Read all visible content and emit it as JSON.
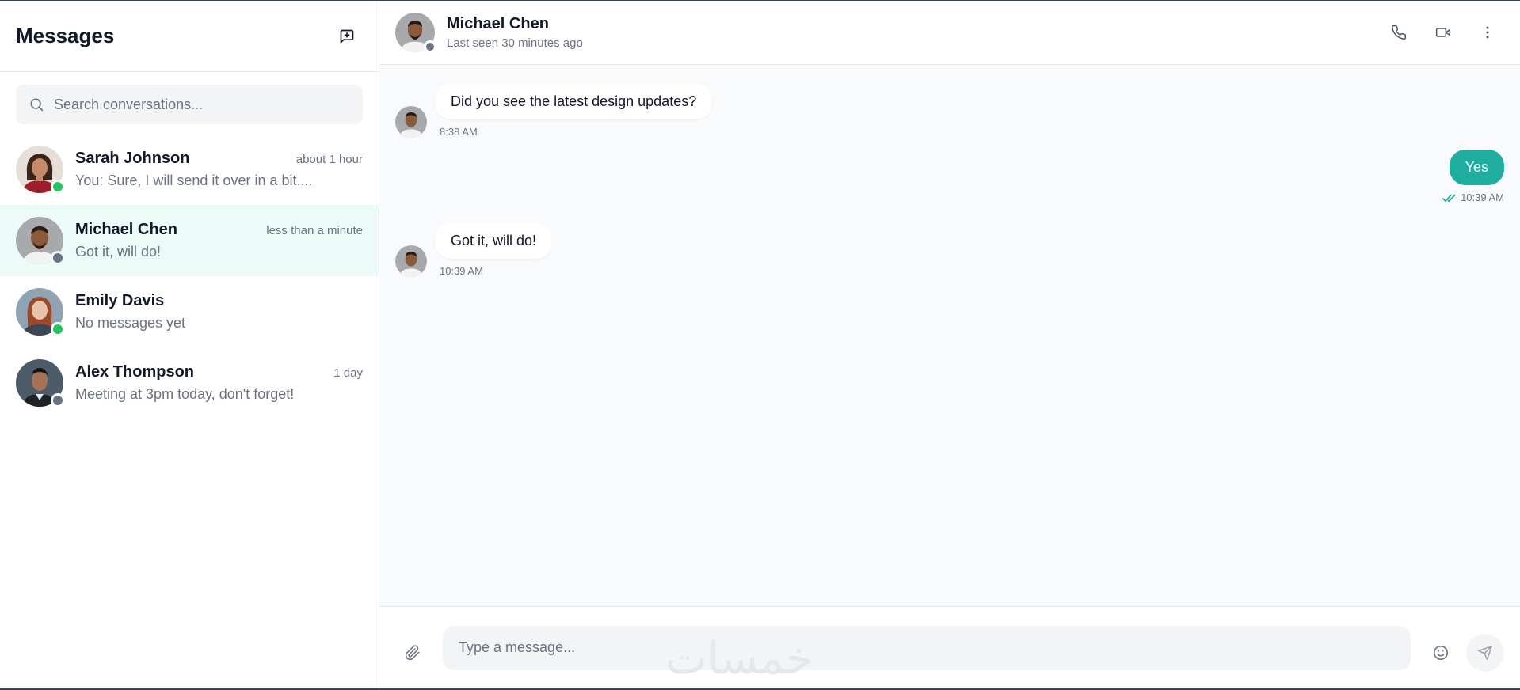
{
  "sidebar": {
    "title": "Messages",
    "new_chat_icon": "new-message-icon",
    "search": {
      "placeholder": "Search conversations...",
      "value": ""
    },
    "conversations": [
      {
        "name": "Sarah Johnson",
        "time": "about 1 hour",
        "preview": "You: Sure, I will send it over in a bit....",
        "online": true,
        "active": false
      },
      {
        "name": "Michael Chen",
        "time": "less than a minute",
        "preview": "Got it, will do!",
        "online": false,
        "active": true
      },
      {
        "name": "Emily Davis",
        "time": "",
        "preview": "No messages yet",
        "online": true,
        "active": false
      },
      {
        "name": "Alex Thompson",
        "time": "1 day",
        "preview": "Meeting at 3pm today, don't forget!",
        "online": false,
        "active": false
      }
    ]
  },
  "chat": {
    "contact_name": "Michael Chen",
    "contact_status": "Last seen 30 minutes ago",
    "actions": [
      "phone-icon",
      "video-icon",
      "more-vertical-icon"
    ],
    "messages": [
      {
        "direction": "in",
        "text": "Did you see the latest design updates?",
        "time": "8:38 AM"
      },
      {
        "direction": "out",
        "text": "Yes",
        "time": "10:39 AM",
        "read": true
      },
      {
        "direction": "in",
        "text": "Got it, will do!",
        "time": "10:39 AM"
      }
    ],
    "composer": {
      "placeholder": "Type a message...",
      "value": ""
    }
  },
  "watermark": "خمسات",
  "colors": {
    "accent": "#1fada0",
    "active_row": "#ecfaf8",
    "online": "#22c55e",
    "offline": "#6b7280",
    "text_muted": "#6b7280"
  }
}
